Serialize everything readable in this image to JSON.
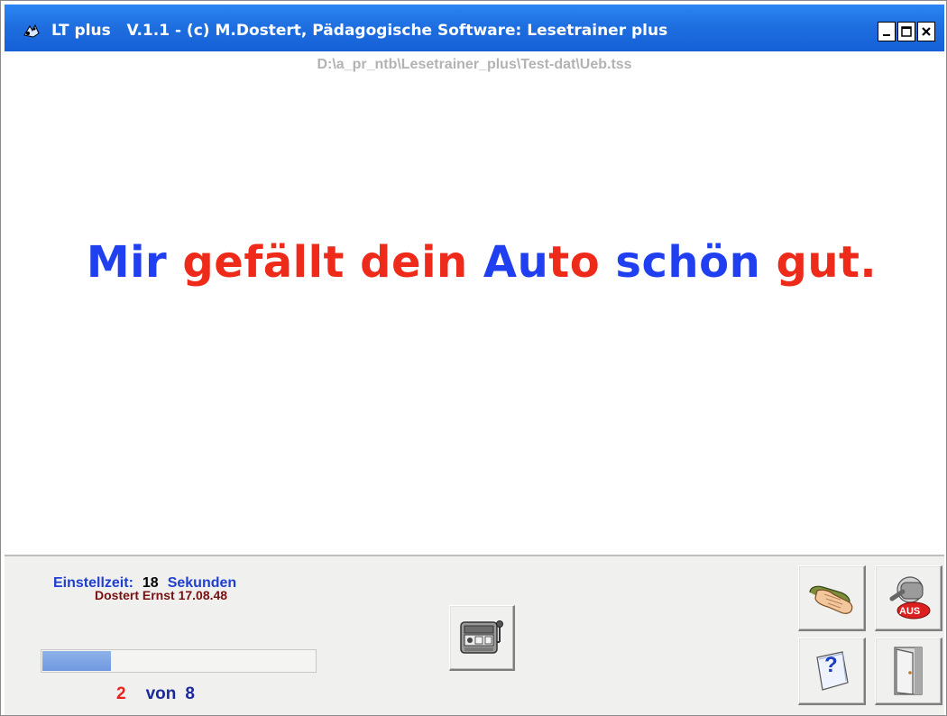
{
  "window": {
    "title": "LT plus   V.1.1 - (c) M.Dostert, Pädagogische Software: Lesetrainer plus",
    "buttons": {
      "minimize": "_",
      "maximize": "□",
      "close": "×"
    }
  },
  "file_path": "D:\\a_pr_ntb\\Lesetrainer_plus\\Test-dat\\Ueb.tss",
  "sentence": {
    "words": [
      {
        "text": "Mir ",
        "color": "#1f3ff0"
      },
      {
        "text": "gefällt ",
        "color": "#ee2b1a"
      },
      {
        "text": "dein ",
        "color": "#ee2b1a"
      },
      {
        "text": "Au",
        "color": "#1f3ff0"
      },
      {
        "text": "to ",
        "color": "#ee2b1a"
      },
      {
        "text": "schön ",
        "color": "#1f3ff0"
      },
      {
        "text": "gut.",
        "color": "#ee2b1a"
      }
    ]
  },
  "status": {
    "settime_label": "Einstellzeit:",
    "settime_value": "18",
    "settime_unit": "Sekunden",
    "user": "Dostert Ernst 17.08.48",
    "progress_fraction": 0.25,
    "current": "2",
    "of_label": "von",
    "total": "8"
  },
  "buttons": {
    "slot_machine": "slot-machine-icon",
    "hand": "hand-icon",
    "aus": "AUS",
    "help": "?",
    "exit": "door-icon"
  },
  "colors": {
    "titlebar": "#1f6fe0",
    "accent_blue": "#1f3ff0",
    "accent_red": "#ee2b1a"
  }
}
